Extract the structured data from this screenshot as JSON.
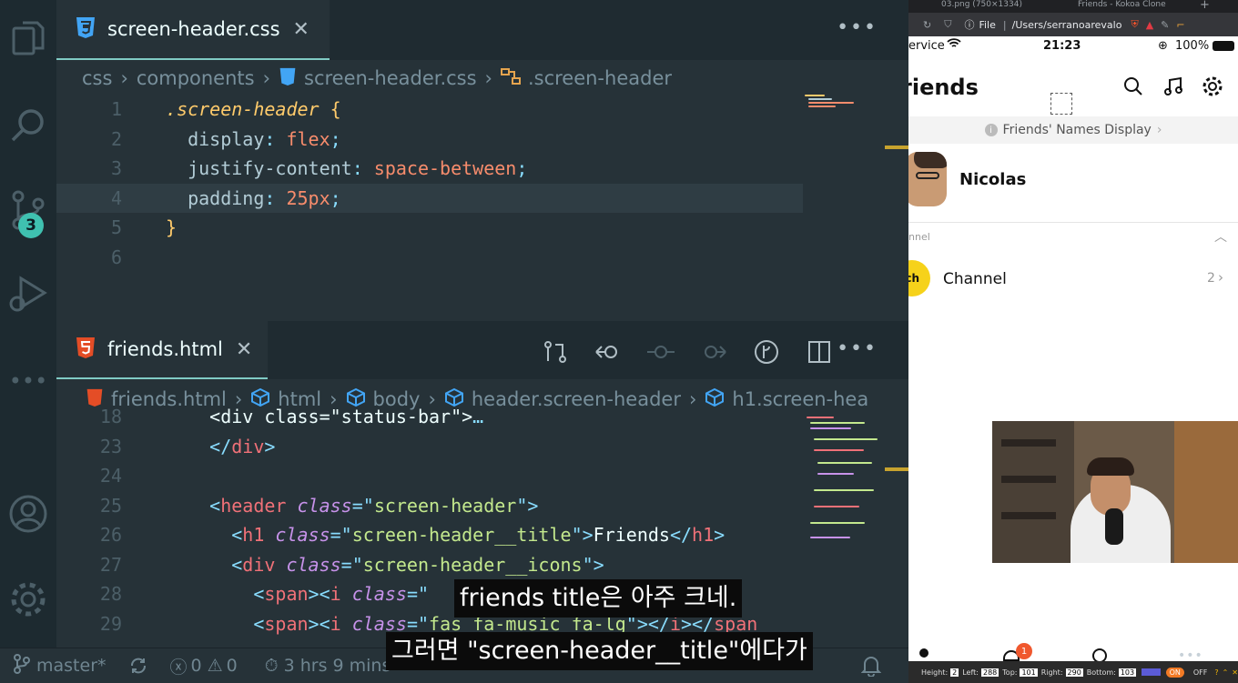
{
  "activity_bar": {
    "scm_badge": "3"
  },
  "css_editor": {
    "tab_title": "screen-header.css",
    "breadcrumb": [
      "css",
      "components",
      "screen-header.css",
      ".screen-header"
    ],
    "lines": [
      {
        "n": "1",
        "tokens": [
          {
            "t": ".screen-header",
            "c": "c-sel"
          },
          {
            "t": " {",
            "c": "c-brace"
          }
        ]
      },
      {
        "n": "2",
        "tokens": [
          {
            "t": "  display",
            "c": "c-prop"
          },
          {
            "t": ": ",
            "c": "c-punc"
          },
          {
            "t": "flex",
            "c": "c-val"
          },
          {
            "t": ";",
            "c": "c-punc"
          }
        ]
      },
      {
        "n": "3",
        "tokens": [
          {
            "t": "  justify-content",
            "c": "c-prop"
          },
          {
            "t": ": ",
            "c": "c-punc"
          },
          {
            "t": "space-between",
            "c": "c-val"
          },
          {
            "t": ";",
            "c": "c-punc"
          }
        ]
      },
      {
        "n": "4",
        "tokens": [
          {
            "t": "  padding",
            "c": "c-prop"
          },
          {
            "t": ": ",
            "c": "c-punc"
          },
          {
            "t": "25px",
            "c": "c-val"
          },
          {
            "t": ";",
            "c": "c-punc"
          }
        ]
      },
      {
        "n": "5",
        "tokens": [
          {
            "t": "}",
            "c": "c-brace"
          }
        ]
      },
      {
        "n": "6",
        "tokens": []
      }
    ]
  },
  "html_editor": {
    "tab_title": "friends.html",
    "breadcrumb": [
      "friends.html",
      "html",
      "body",
      "header.screen-header",
      "h1.screen-hea"
    ],
    "lines": [
      {
        "n": "18",
        "tokens": [
          {
            "t": "    <div class=\"status-bar\">",
            "c": "c-text"
          },
          {
            "t": "…",
            "c": "c-punc"
          }
        ]
      },
      {
        "n": "23",
        "tokens": [
          {
            "t": "    </",
            "c": "c-punc"
          },
          {
            "t": "div",
            "c": "c-tag"
          },
          {
            "t": ">",
            "c": "c-punc"
          }
        ]
      },
      {
        "n": "24",
        "tokens": []
      },
      {
        "n": "25",
        "tokens": [
          {
            "t": "    <",
            "c": "c-punc"
          },
          {
            "t": "header",
            "c": "c-tag"
          },
          {
            "t": " class",
            "c": "c-attr"
          },
          {
            "t": "=\"",
            "c": "c-punc"
          },
          {
            "t": "screen-header",
            "c": "c-str"
          },
          {
            "t": "\">",
            "c": "c-punc"
          }
        ]
      },
      {
        "n": "26",
        "tokens": [
          {
            "t": "      <",
            "c": "c-punc"
          },
          {
            "t": "h1",
            "c": "c-tag"
          },
          {
            "t": " class",
            "c": "c-attr"
          },
          {
            "t": "=\"",
            "c": "c-punc"
          },
          {
            "t": "screen-header__title",
            "c": "c-str"
          },
          {
            "t": "\">",
            "c": "c-punc"
          },
          {
            "t": "Friends",
            "c": "c-text"
          },
          {
            "t": "</",
            "c": "c-punc"
          },
          {
            "t": "h1",
            "c": "c-tag"
          },
          {
            "t": ">",
            "c": "c-punc"
          }
        ]
      },
      {
        "n": "27",
        "tokens": [
          {
            "t": "      <",
            "c": "c-punc"
          },
          {
            "t": "div",
            "c": "c-tag"
          },
          {
            "t": " class",
            "c": "c-attr"
          },
          {
            "t": "=\"",
            "c": "c-punc"
          },
          {
            "t": "screen-header__icons",
            "c": "c-str"
          },
          {
            "t": "\">",
            "c": "c-punc"
          }
        ]
      },
      {
        "n": "28",
        "tokens": [
          {
            "t": "        <",
            "c": "c-punc"
          },
          {
            "t": "span",
            "c": "c-tag"
          },
          {
            "t": "><",
            "c": "c-punc"
          },
          {
            "t": "i",
            "c": "c-tag"
          },
          {
            "t": " class",
            "c": "c-attr"
          },
          {
            "t": "=\"",
            "c": "c-punc"
          }
        ]
      },
      {
        "n": "29",
        "tokens": [
          {
            "t": "        <",
            "c": "c-punc"
          },
          {
            "t": "span",
            "c": "c-tag"
          },
          {
            "t": "><",
            "c": "c-punc"
          },
          {
            "t": "i",
            "c": "c-tag"
          },
          {
            "t": " class",
            "c": "c-attr"
          },
          {
            "t": "=\"",
            "c": "c-punc"
          },
          {
            "t": "fas fa-music fa-lg",
            "c": "c-str"
          },
          {
            "t": "\"></",
            "c": "c-punc"
          },
          {
            "t": "i",
            "c": "c-tag"
          },
          {
            "t": "></",
            "c": "c-punc"
          },
          {
            "t": "span",
            "c": "c-tag"
          }
        ]
      }
    ]
  },
  "status_bar": {
    "branch": "master*",
    "errors": "0",
    "warnings": "0",
    "time": "3 hrs 9 mins"
  },
  "browser": {
    "tabs": [
      "03.png (750×1334)",
      "Friends - Kokoa Clone"
    ],
    "address_prefix": "File",
    "address": "/Users/serranoarevalo",
    "phone": {
      "carrier": "ervice",
      "time": "21:23",
      "battery": "100%",
      "title": "riends",
      "names_display": "Friends' Names Display",
      "profile_name": "Nicolas",
      "channel_header": "nnel",
      "channel_label": "Channel",
      "channel_count": "2",
      "chat_badge": "1"
    },
    "devtools": {
      "height_label": "Height:",
      "height_value": "2",
      "left_label": "Left:",
      "left_value": "288",
      "top_label": "Top:",
      "top_value": "101",
      "right_label": "Right:",
      "right_value": "290",
      "bottom_label": "Bottom:",
      "bottom_value": "103",
      "on_label": "ON",
      "off_label": "OFF"
    }
  },
  "subtitles": {
    "line1": "friends title은 아주 크네.",
    "line2": "그러면 \"screen-header__title\"에다가"
  }
}
